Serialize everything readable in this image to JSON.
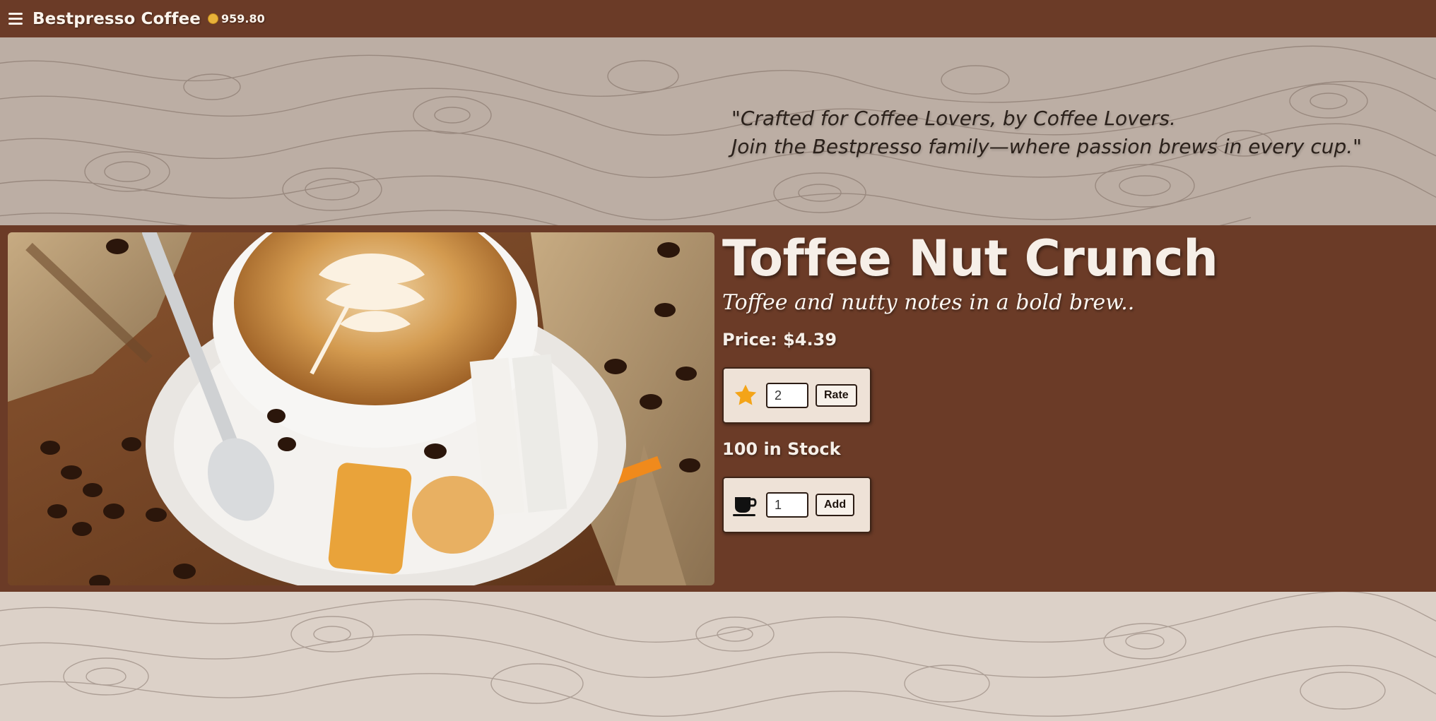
{
  "nav": {
    "menu_icon": "hamburger-icon",
    "brand": "Bestpresso Coffee",
    "coin_icon": "coin-icon",
    "balance": "959.80"
  },
  "hero": {
    "quote_line1": "\"Crafted for Coffee Lovers, by Coffee Lovers.",
    "quote_line2": "Join the Bestpresso family—where passion brews in every cup.\""
  },
  "product": {
    "image_icon": "coffee-latte-photo",
    "name": "Toffee Nut Crunch",
    "tagline": "Toffee and nutty notes in a bold brew..",
    "price": "Price: $4.39",
    "stock": "100 in Stock",
    "rating": {
      "icon": "star-icon",
      "value": "2",
      "button": "Rate"
    },
    "cart": {
      "icon": "coffee-cup-icon",
      "quantity": "1",
      "button": "Add"
    }
  },
  "colors": {
    "brown": "#6b3b27",
    "cream": "#eee2d7",
    "star": "#f4a418"
  }
}
